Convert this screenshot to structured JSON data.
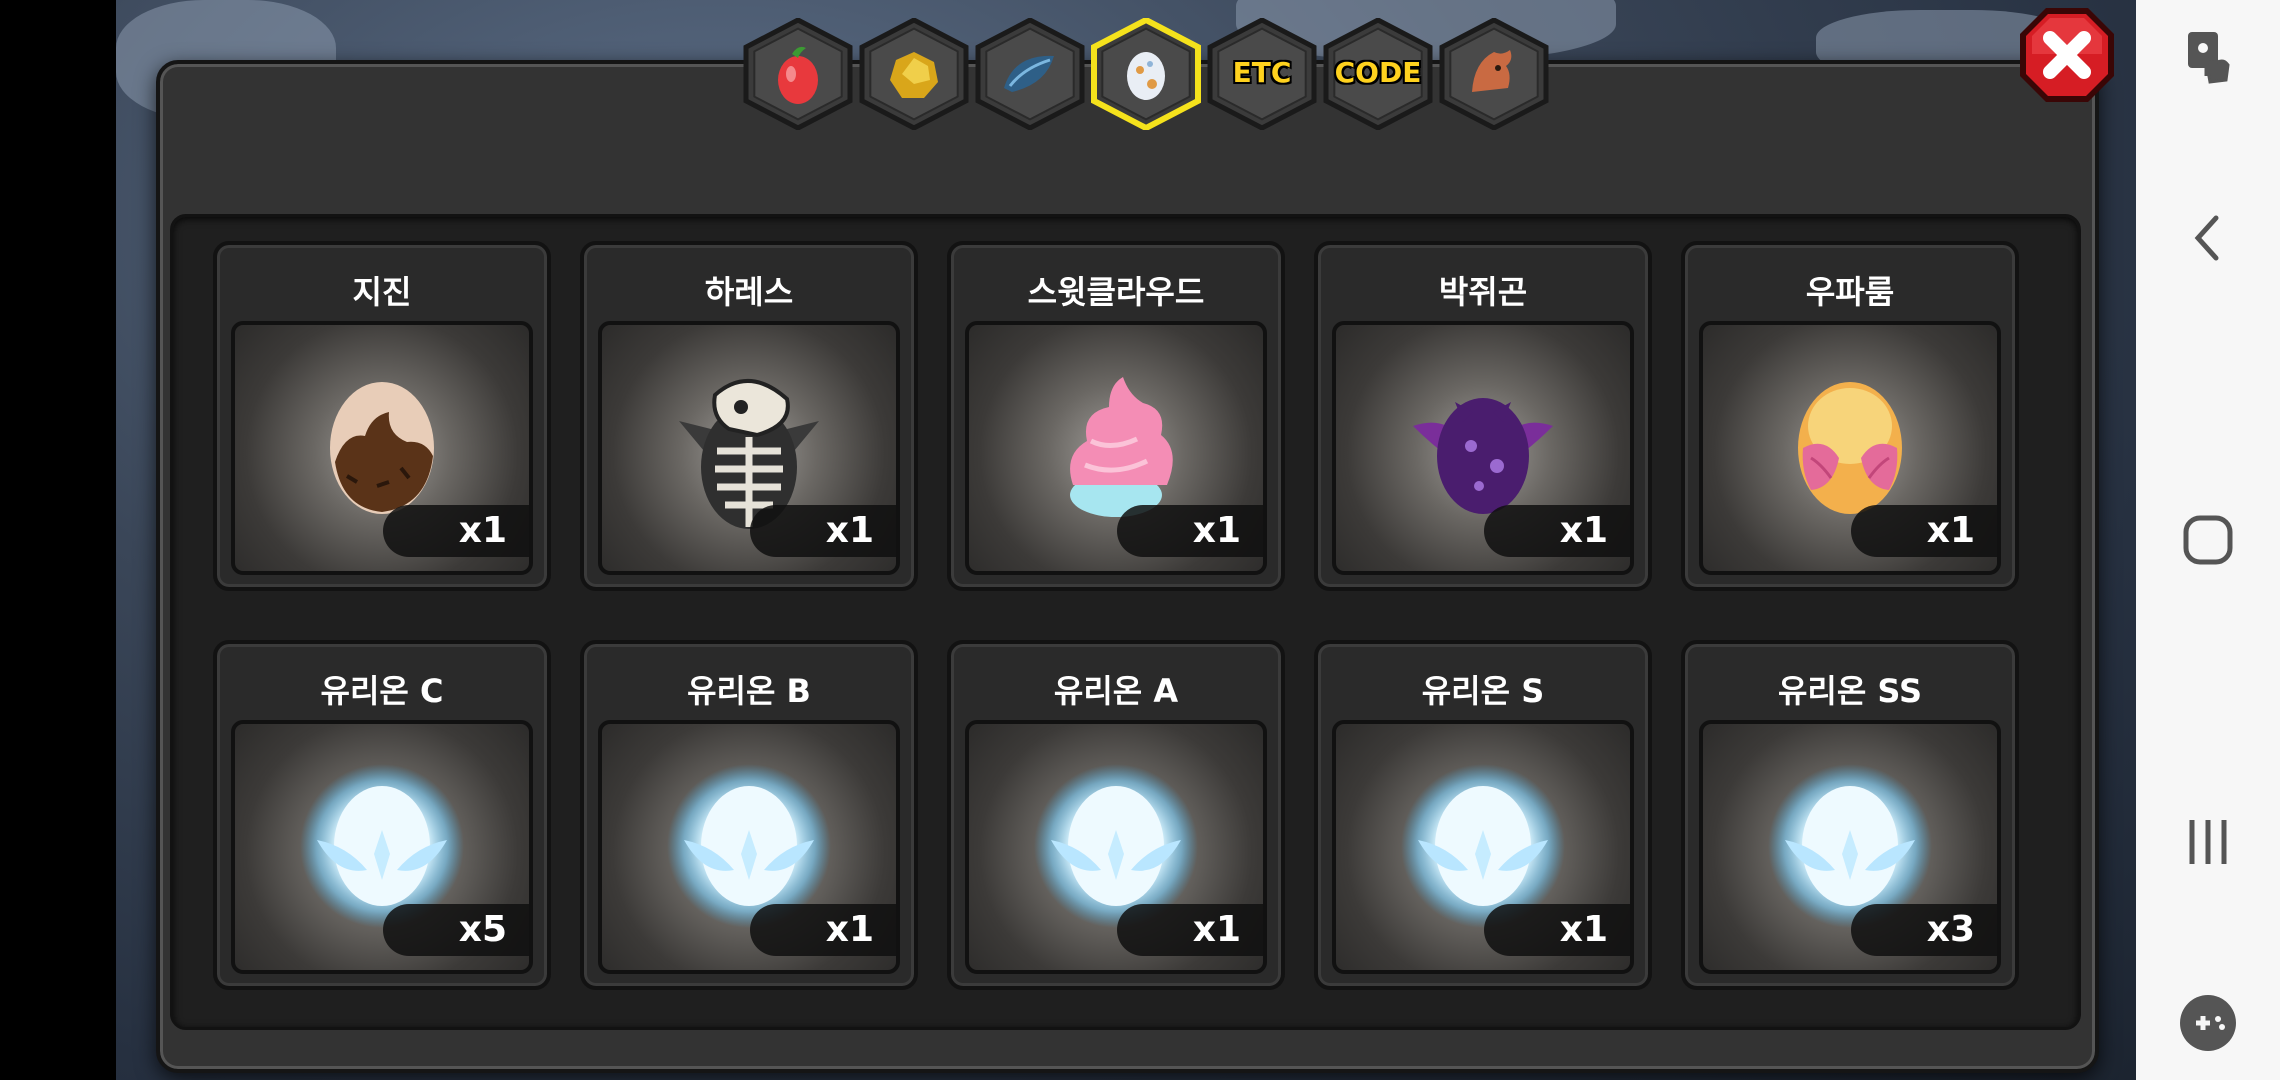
{
  "category_tabs": [
    {
      "id": "fruit",
      "icon": "fruit-icon",
      "label": ""
    },
    {
      "id": "ore",
      "icon": "ore-icon",
      "label": ""
    },
    {
      "id": "feather",
      "icon": "feather-icon",
      "label": ""
    },
    {
      "id": "egg",
      "icon": "egg-icon",
      "label": "",
      "selected": true
    },
    {
      "id": "etc",
      "icon": "",
      "label": "ETC"
    },
    {
      "id": "code",
      "icon": "",
      "label": "CODE"
    },
    {
      "id": "dragon",
      "icon": "dragon-icon",
      "label": ""
    }
  ],
  "items": [
    {
      "name": "지진",
      "count": "x1",
      "egg": "earth-egg"
    },
    {
      "name": "하레스",
      "count": "x1",
      "egg": "skeleton-egg"
    },
    {
      "name": "스윗클라우드",
      "count": "x1",
      "egg": "cotton-candy-egg"
    },
    {
      "name": "박쥐곤",
      "count": "x1",
      "egg": "bat-egg"
    },
    {
      "name": "우파룸",
      "count": "x1",
      "egg": "shell-egg"
    },
    {
      "name": "유리온 C",
      "count": "x5",
      "egg": "glowing-egg"
    },
    {
      "name": "유리온 B",
      "count": "x1",
      "egg": "glowing-egg"
    },
    {
      "name": "유리온 A",
      "count": "x1",
      "egg": "glowing-egg"
    },
    {
      "name": "유리온 S",
      "count": "x1",
      "egg": "glowing-egg"
    },
    {
      "name": "유리온 SS",
      "count": "x3",
      "egg": "glowing-egg"
    }
  ],
  "colors": {
    "tab_selected_border": "#f5e21c",
    "tab_label": "#ffd21e",
    "close_button": "#d61d24"
  },
  "nav_bar": {
    "icons": [
      "touch-assist-icon",
      "back-icon",
      "home-icon",
      "recents-icon",
      "game-launcher-icon"
    ]
  }
}
